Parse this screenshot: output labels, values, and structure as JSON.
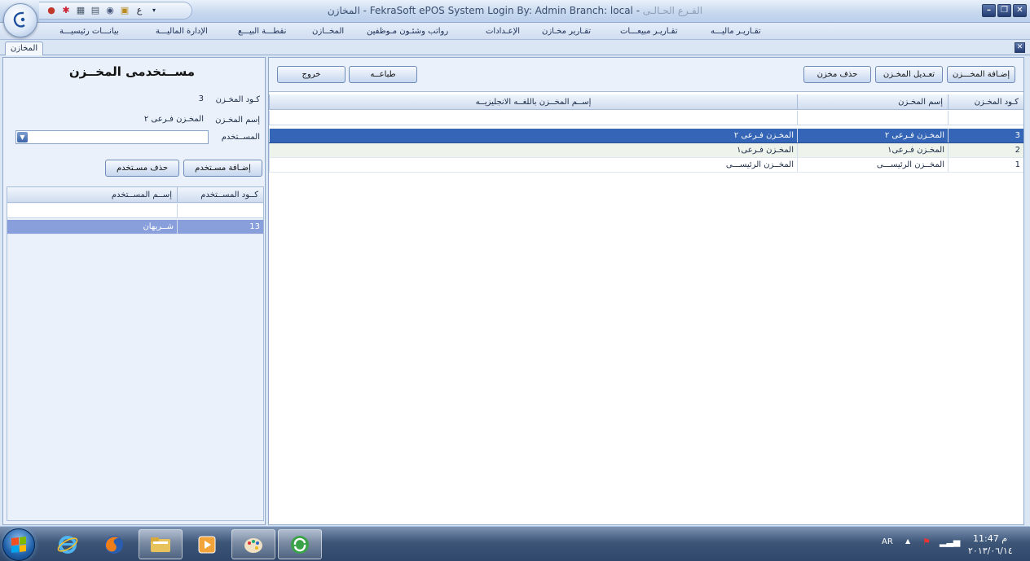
{
  "window": {
    "title_main": "المخازن - FekraSoft ePOS System   Login By: Admin   Branch: local -",
    "title_branch": " الفـرع الحـالـى",
    "qat_lang": "ع"
  },
  "menu": [
    {
      "label": "تقـاريـر ماليـــه"
    },
    {
      "label": "تقـاريـر مبيعـــات"
    },
    {
      "label": "تقـارير مخـازن"
    },
    {
      "label": "الإعـدادات"
    },
    {
      "label": "رواتب وشئـون مـوظفين"
    },
    {
      "label": "المخــازن"
    },
    {
      "label": "نقطـــة البيـــع"
    },
    {
      "label": "الإدارة الماليـــة"
    },
    {
      "label": "بيانـــات رئيسيـــة"
    }
  ],
  "doc_tab": {
    "label": "المخازن"
  },
  "left": {
    "title": "مســتخدمى المخــزن",
    "store_code_label": "كـود المخـزن",
    "store_code_value": "3",
    "store_name_label": "إسم المخـزن",
    "store_name_value": "المخـزن فـرعى ٢",
    "user_label": "المســتخدم",
    "user_value": "",
    "add_user_label": "إضـافة مسـتخدم",
    "delete_user_label": "حذف مسـتخدم",
    "users_grid": {
      "columns": [
        "كــود المســتخدم",
        "إســم المســتخدم"
      ],
      "rows": [
        {
          "code": "13",
          "name": "شــريهان"
        }
      ]
    }
  },
  "right": {
    "buttons": {
      "add": "إضـافة المخـــزن",
      "edit": "تعـديل المخـزن",
      "delete": "حذف مخزن",
      "print": "طباعــه",
      "exit": "خروج"
    },
    "grid": {
      "columns": [
        "كـود المخـزن",
        "إسم المخـزن",
        "إســم المخــزن باللغــه الانجليزيــه"
      ],
      "rows": [
        {
          "code": "3",
          "name": "المخـزن فـرعى ٢",
          "name_en": "المخـزن فـرعى ٢"
        },
        {
          "code": "2",
          "name": "المخـزن فـرعى١",
          "name_en": "المخـزن فـرعى١"
        },
        {
          "code": "1",
          "name": "المخــزن الرئيســـى",
          "name_en": "المخــزن الرئيســـى"
        }
      ]
    }
  },
  "taskbar": {
    "lang": "AR",
    "time": "11:47 م",
    "date": "٢٠١٣/٠٦/١٤"
  },
  "colors": {
    "selected_row": "#3465b6",
    "selected_user_row": "#889fdc",
    "alt_row": "#eef4ec"
  }
}
